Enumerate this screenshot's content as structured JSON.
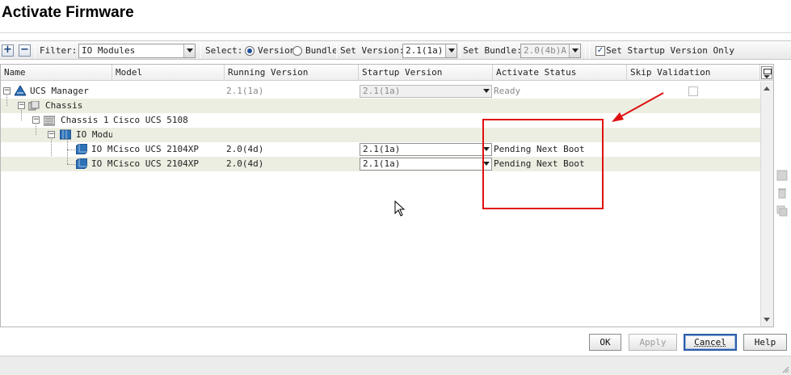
{
  "window": {
    "title": "Activate Firmware"
  },
  "toolbar": {
    "add_label": "+",
    "remove_label": "−",
    "filter_label": "Filter:",
    "filter_value": "IO Modules",
    "select_label": "Select:",
    "select_options": [
      {
        "label": "Version",
        "selected": true
      },
      {
        "label": "Bundle",
        "selected": false
      }
    ],
    "set_version_label": "Set Version:",
    "set_version_value": "2.1(1a)",
    "set_bundle_label": "Set Bundle:",
    "set_bundle_value": "2.0(4b)A",
    "startup_only_label": "Set Startup Version Only",
    "startup_only_checked": true
  },
  "table": {
    "columns": [
      "Name",
      "Model",
      "Running Version",
      "Startup Version",
      "Activate Status",
      "Skip Validation"
    ],
    "rows": [
      {
        "name": "UCS Manager",
        "model": "",
        "running": "2.1(1a)",
        "startup": "2.1(1a)",
        "status": "Ready",
        "skip": true,
        "level": 0,
        "icon": "ucs-manager-icon"
      },
      {
        "name": "Chassis",
        "model": "",
        "running": "",
        "startup": "",
        "status": "",
        "skip": false,
        "level": 1,
        "icon": "chassis-folder-icon"
      },
      {
        "name": "Chassis 1",
        "model": "Cisco UCS 5108",
        "running": "",
        "startup": "",
        "status": "",
        "skip": false,
        "level": 2,
        "icon": "chassis-icon"
      },
      {
        "name": "IO Modul",
        "model": "",
        "running": "",
        "startup": "",
        "status": "",
        "skip": false,
        "level": 3,
        "icon": "io-module-folder-icon"
      },
      {
        "name": "IO M",
        "model": "Cisco UCS 2104XP",
        "running": "2.0(4d)",
        "startup": "2.1(1a)",
        "status": "Pending Next Boot",
        "skip": false,
        "level": 4,
        "icon": "io-module-icon"
      },
      {
        "name": "IO M",
        "model": "Cisco UCS 2104XP",
        "running": "2.0(4d)",
        "startup": "2.1(1a)",
        "status": "Pending Next Boot",
        "skip": false,
        "level": 4,
        "icon": "io-module-icon"
      }
    ]
  },
  "buttons": {
    "ok": "OK",
    "apply": "Apply",
    "cancel": "Cancel",
    "help": "Help"
  },
  "colors": {
    "annotation": "#e01010",
    "row_alt": "#eceee1",
    "accent": "#2b5ea8"
  }
}
